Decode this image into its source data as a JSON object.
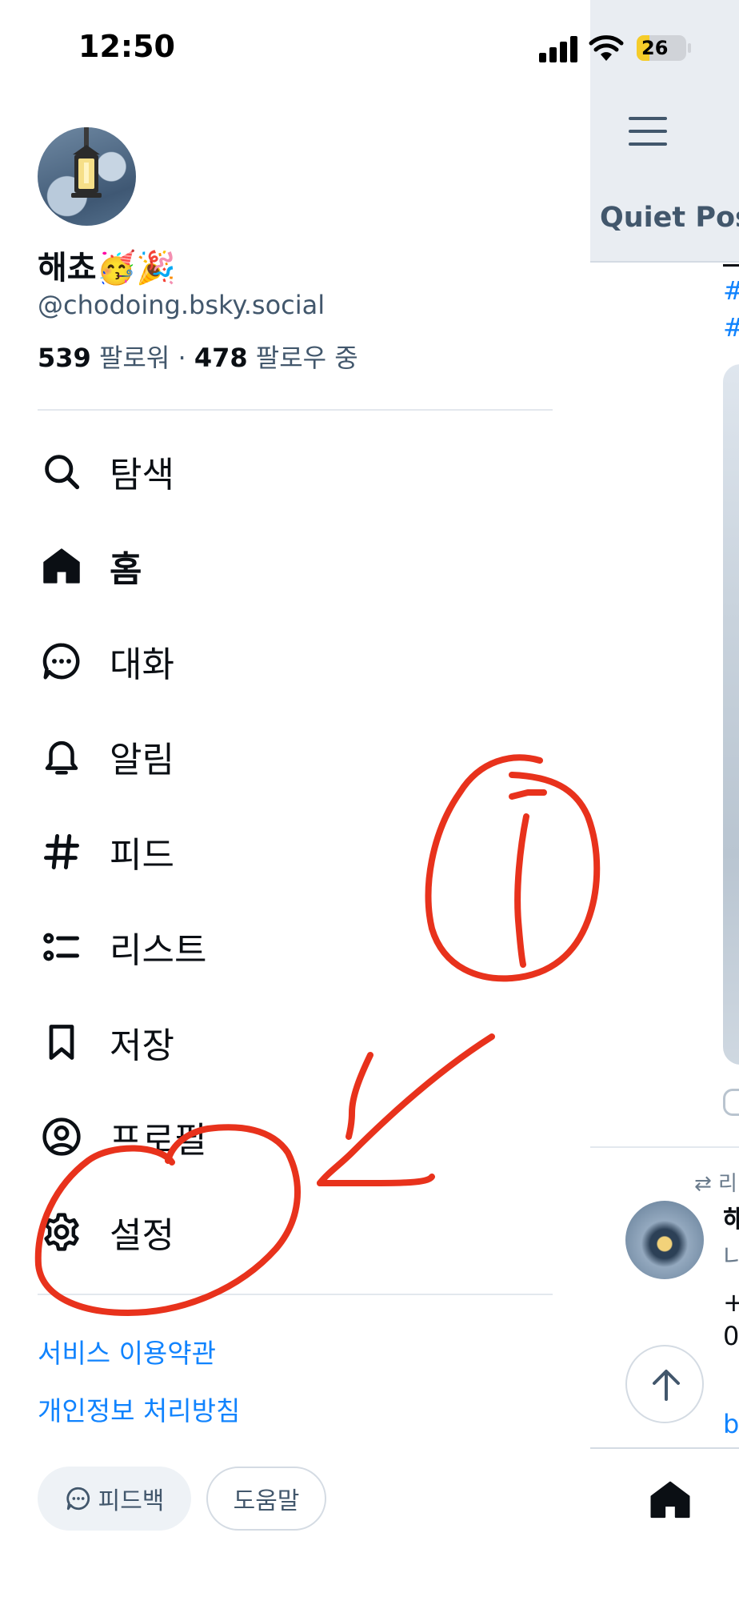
{
  "status_bar": {
    "time": "12:50",
    "battery": "26"
  },
  "profile": {
    "display_name": "해쵸🥳🎉",
    "handle": "@chodoing.bsky.social",
    "followers_count": "539",
    "followers_label": "팔로워",
    "following_count": "478",
    "following_label": "팔로우 중",
    "separator": "·"
  },
  "nav": {
    "items": [
      {
        "label": "탐색",
        "icon": "search-icon"
      },
      {
        "label": "홈",
        "icon": "home-icon",
        "active": true
      },
      {
        "label": "대화",
        "icon": "chat-icon"
      },
      {
        "label": "알림",
        "icon": "bell-icon"
      },
      {
        "label": "피드",
        "icon": "hash-icon"
      },
      {
        "label": "리스트",
        "icon": "list-icon"
      },
      {
        "label": "저장",
        "icon": "bookmark-icon"
      },
      {
        "label": "프로필",
        "icon": "profile-icon"
      },
      {
        "label": "설정",
        "icon": "gear-icon"
      }
    ]
  },
  "footer": {
    "terms_link": "서비스 이용약관",
    "privacy_link": "개인정보 처리방침",
    "feedback_button": "피드백",
    "help_button": "도움말"
  },
  "peek": {
    "feed_title": "Quiet Post",
    "hash1": "#",
    "hash2": "#",
    "repost_label": "⇄ 리",
    "post_name": "해",
    "post_sub": "니",
    "post_line1": "+",
    "post_line2": "0",
    "post_link": "b"
  },
  "annotation": {
    "marker_text": "①",
    "color": "#e8321c"
  },
  "colors": {
    "accent": "#1083fe",
    "text": "#0b0f14",
    "muted": "#42576c",
    "annotation": "#e8321c"
  }
}
